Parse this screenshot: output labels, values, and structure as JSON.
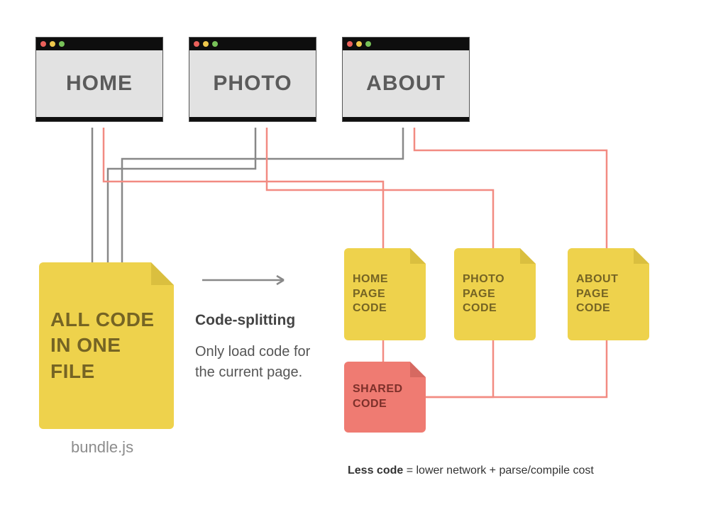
{
  "windows": {
    "home": "HOME",
    "photo": "PHOTO",
    "about": "ABOUT"
  },
  "bundle": {
    "label": "ALL CODE IN ONE FILE",
    "caption": "bundle.js"
  },
  "center": {
    "heading": "Code-splitting",
    "sub": "Only load code for the current page."
  },
  "chunks": {
    "home": "HOME PAGE CODE",
    "photo": "PHOTO PAGE CODE",
    "about": "ABOUT PAGE CODE",
    "shared": "SHARED CODE"
  },
  "footnote": {
    "bold": "Less code",
    "rest": " = lower network + parse/compile cost"
  },
  "colors": {
    "file_yellow": "#eed24c",
    "file_red": "#ef7b72",
    "wire_gray": "#888888",
    "wire_red": "#f28b82"
  }
}
